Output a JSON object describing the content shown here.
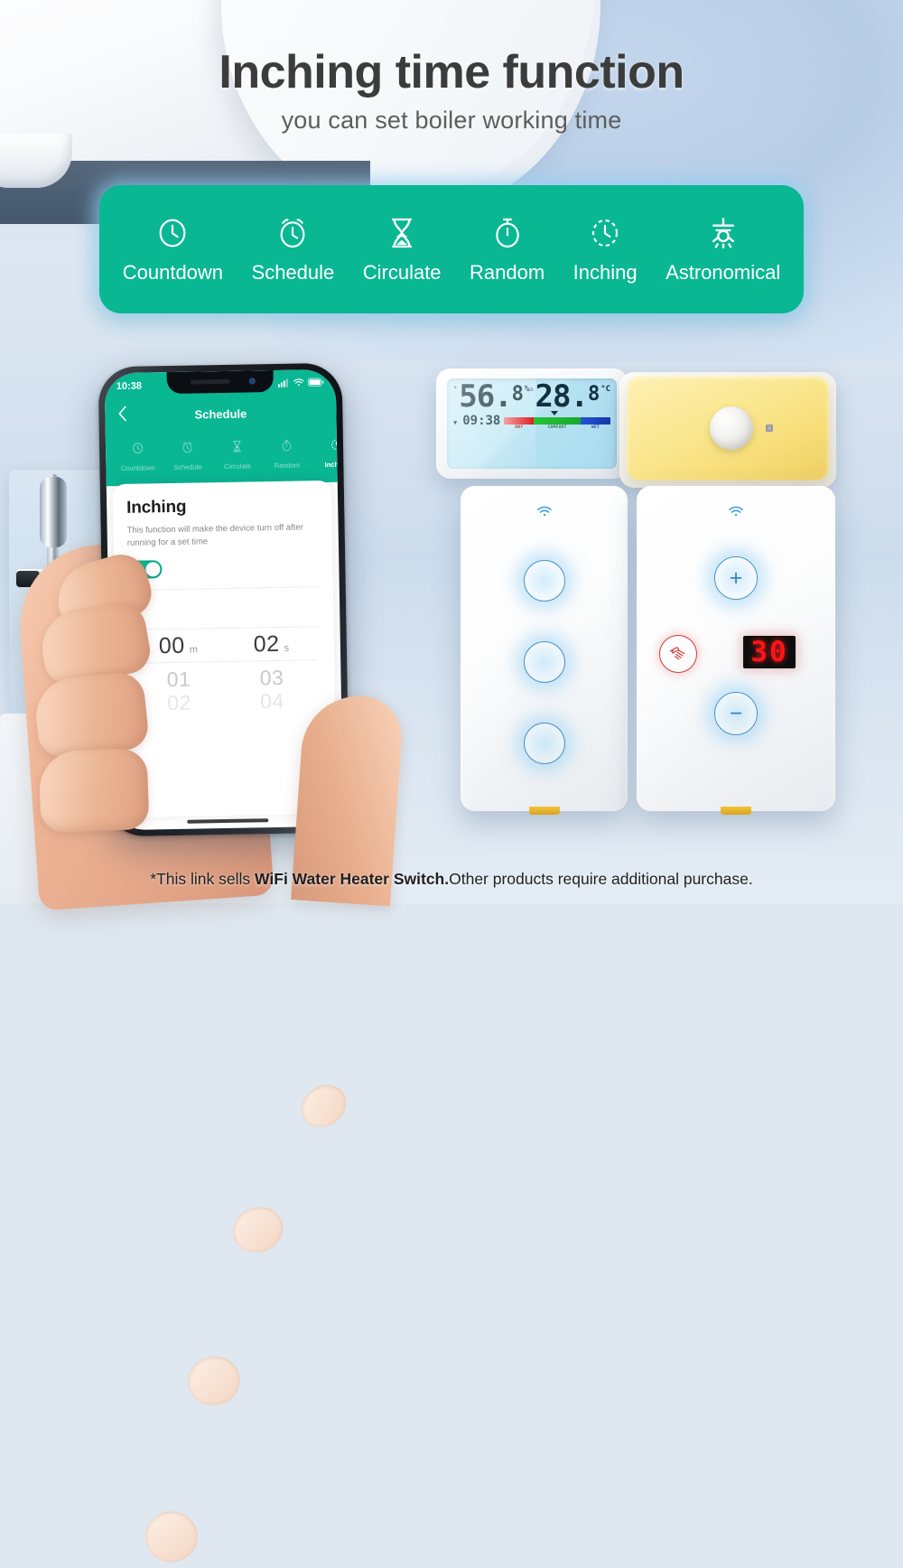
{
  "header": {
    "title": "Inching time function",
    "subtitle": "you can set boiler working time"
  },
  "feature_bar": {
    "accent_color": "#09b793",
    "items": [
      {
        "icon": "clock-icon",
        "label": "Countdown"
      },
      {
        "icon": "alarm-clock-icon",
        "label": "Schedule"
      },
      {
        "icon": "hourglass-icon",
        "label": "Circulate"
      },
      {
        "icon": "stopwatch-icon",
        "label": "Random"
      },
      {
        "icon": "dashed-clock-icon",
        "label": "Inching"
      },
      {
        "icon": "sun-horizon-icon",
        "label": "Astronomical"
      }
    ]
  },
  "phone": {
    "status_bar": {
      "time": "10:38",
      "signal_icon": "cellular-signal-icon",
      "wifi_icon": "wifi-icon",
      "battery_icon": "battery-full-icon"
    },
    "nav": {
      "back_icon": "chevron-left-icon",
      "title": "Schedule"
    },
    "tabs": [
      {
        "icon": "clock-icon",
        "label": "Countdown",
        "active": false
      },
      {
        "icon": "alarm-clock-icon",
        "label": "Schedule",
        "active": false
      },
      {
        "icon": "hourglass-icon",
        "label": "Circulate",
        "active": false
      },
      {
        "icon": "stopwatch-icon",
        "label": "Random",
        "active": false
      },
      {
        "icon": "dashed-clock-icon",
        "label": "Inching",
        "active": true
      }
    ],
    "sheet": {
      "title": "Inching",
      "description": "This function will make the device turn off after running for a set time",
      "toggle_state": "on"
    },
    "picker": {
      "selected": {
        "minutes": "00",
        "minutes_unit": "m",
        "seconds": "02",
        "seconds_unit": "s"
      },
      "next": {
        "minutes": "01",
        "seconds": "03"
      },
      "next2": {
        "minutes": "02",
        "seconds": "04"
      }
    }
  },
  "sensor": {
    "humidity_value": "56.",
    "humidity_decimal": "8",
    "humidity_unit": "%",
    "humidity_marker": "°",
    "temperature_value": "28.",
    "temperature_decimal": "8",
    "temperature_unit": "°C",
    "temperature_marker": "⌂",
    "time": "09:38",
    "time_marker": "▼",
    "comfort_scale": [
      "DRY",
      "COMFORT",
      "WET"
    ],
    "comfort_colors": [
      "#e01f1f",
      "#1aa82b",
      "#1637a8"
    ]
  },
  "pir_sensor": {
    "body_color": "#f9e48a",
    "dome_icon": "pir-lens-icon",
    "led_icon": "indicator-led-icon"
  },
  "switch_left": {
    "wifi_icon": "wifi-icon",
    "buttons": [
      "touch-button-1",
      "touch-button-2",
      "touch-button-3"
    ]
  },
  "switch_right": {
    "wifi_icon": "wifi-icon",
    "plus_label": "+",
    "minus_label": "−",
    "shower_icon": "shower-head-icon",
    "display_value": "30"
  },
  "disclaimer": {
    "prefix": "*This link sells ",
    "bold": "WiFi Water Heater Switch.",
    "suffix": "Other products require additional purchase."
  }
}
